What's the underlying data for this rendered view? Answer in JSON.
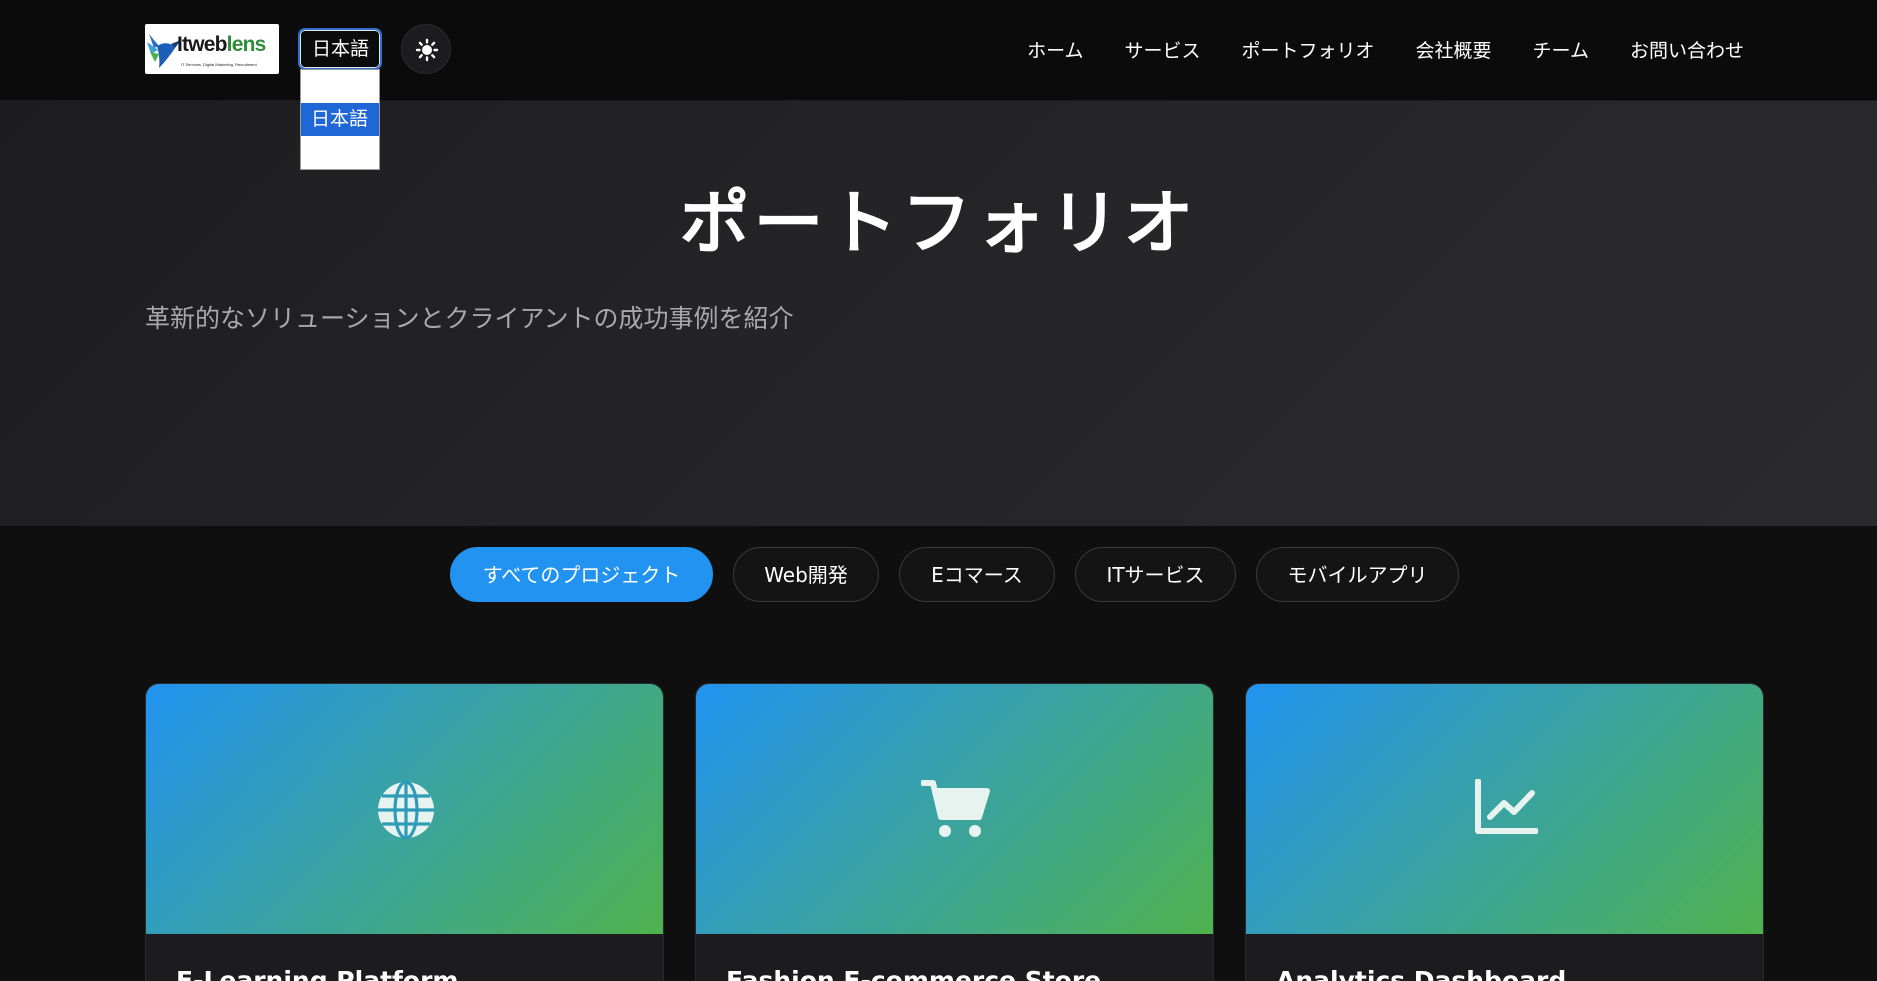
{
  "header": {
    "logo": {
      "brand_main": "Itweb",
      "brand_accent": "lens",
      "tagline": "IT Services, Digital Marketing, Recruitment"
    },
    "language_select": {
      "selected": "日本語",
      "options": [
        "",
        "日本語",
        ""
      ]
    },
    "theme_toggle_icon": "sun-icon",
    "nav": [
      "ホーム",
      "サービス",
      "ポートフォリオ",
      "会社概要",
      "チーム",
      "お問い合わせ"
    ]
  },
  "hero": {
    "title": "ポートフォリオ",
    "subtitle": "革新的なソリューションとクライアントの成功事例を紹介"
  },
  "filters": {
    "items": [
      "すべてのプロジェクト",
      "Web開発",
      "Eコマース",
      "ITサービス",
      "モバイルアプリ"
    ],
    "active_index": 0
  },
  "projects": [
    {
      "title": "E-Learning Platform",
      "icon": "globe-icon"
    },
    {
      "title": "Fashion E-commerce Store",
      "icon": "shopping-cart-icon"
    },
    {
      "title": "Analytics Dashboard",
      "icon": "line-chart-icon"
    }
  ],
  "colors": {
    "background": "#0f0f10",
    "accent": "#2293f0",
    "gradient_start": "#2193f0",
    "gradient_end": "#4fb24d"
  }
}
